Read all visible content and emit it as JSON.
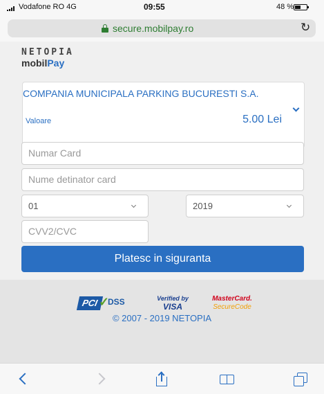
{
  "status_bar": {
    "carrier": "Vodafone RO  4G",
    "time": "09:55",
    "battery_pct": "48 %"
  },
  "browser": {
    "url": "secure.mobilpay.ro",
    "reload_icon": "↻"
  },
  "brand": {
    "logo_top": "NETOPIA",
    "logo_mobil": "mobil",
    "logo_pay": "Pay"
  },
  "merchant": {
    "name": "COMPANIA MUNICIPALA PARKING BUCURESTI S.A.",
    "amount_label": "Valoare",
    "amount": "5.00 Lei"
  },
  "form": {
    "card_number_placeholder": "Numar Card",
    "card_holder_placeholder": "Nume detinator card",
    "exp_month": "01",
    "exp_year": "2019",
    "cvv_placeholder": "CVV2/CVC",
    "submit_label": "Platesc in siguranta"
  },
  "footer": {
    "pci_logo": "PCI",
    "pci_dss": "DSS",
    "visa_by": "Verified by",
    "visa": "VISA",
    "mc_line1": "MasterCard.",
    "mc_line2": "SecureCode",
    "copyright": "© 2007 - 2019 NETOPIA"
  },
  "colors": {
    "accent": "#2a6fc2",
    "secure_green": "#2e7d32"
  }
}
